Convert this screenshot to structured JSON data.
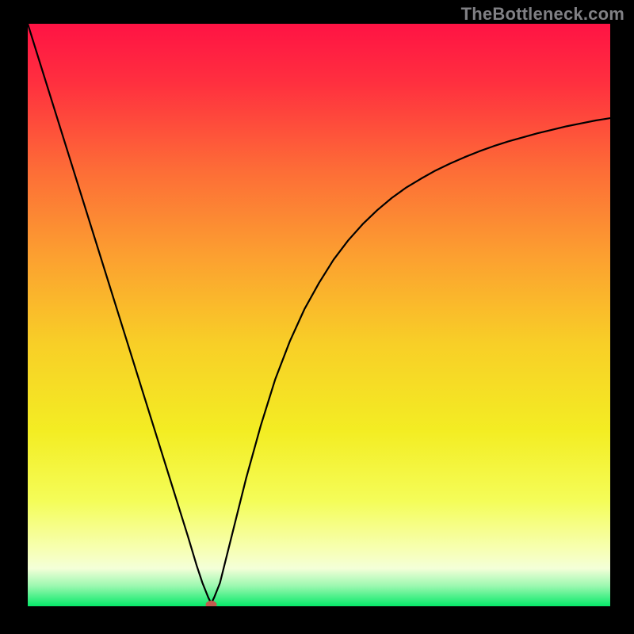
{
  "watermark": "TheBottleneck.com",
  "chart_data": {
    "type": "line",
    "title": "",
    "xlabel": "",
    "ylabel": "",
    "xlim": [
      0,
      100
    ],
    "ylim": [
      0,
      100
    ],
    "grid": false,
    "legend": false,
    "marker": {
      "x": 31.5,
      "y": 0,
      "color": "#c35a4f"
    },
    "series": [
      {
        "name": "curve",
        "color": "#000000",
        "x": [
          0,
          2.5,
          5,
          7.5,
          10,
          12.5,
          15,
          17.5,
          20,
          22.5,
          25,
          27.5,
          29,
          30,
          31,
          31.5,
          32,
          33,
          34,
          35,
          37.5,
          40,
          42.5,
          45,
          47.5,
          50,
          52.5,
          55,
          57.5,
          60,
          62.5,
          65,
          67.5,
          70,
          72.5,
          75,
          77.5,
          80,
          82.5,
          85,
          87.5,
          90,
          92.5,
          95,
          97.5,
          100
        ],
        "y": [
          100,
          92,
          84,
          76,
          68,
          60,
          52,
          44,
          36,
          28,
          20,
          12,
          7,
          4,
          1.5,
          0.5,
          1.5,
          4,
          8,
          12,
          22,
          31,
          39,
          45.5,
          51,
          55.5,
          59.5,
          62.8,
          65.6,
          68,
          70.1,
          71.9,
          73.4,
          74.8,
          76,
          77.1,
          78.1,
          79,
          79.8,
          80.5,
          81.2,
          81.8,
          82.4,
          82.9,
          83.4,
          83.8
        ]
      }
    ],
    "background_gradient": [
      {
        "stop": 0.0,
        "color": "#ff1344"
      },
      {
        "stop": 0.1,
        "color": "#ff2f3f"
      },
      {
        "stop": 0.25,
        "color": "#fd6c37"
      },
      {
        "stop": 0.4,
        "color": "#fca030"
      },
      {
        "stop": 0.55,
        "color": "#f8cf27"
      },
      {
        "stop": 0.7,
        "color": "#f3ed23"
      },
      {
        "stop": 0.82,
        "color": "#f4fd59"
      },
      {
        "stop": 0.9,
        "color": "#f7ffb0"
      },
      {
        "stop": 0.935,
        "color": "#f4ffd8"
      },
      {
        "stop": 0.965,
        "color": "#9cf8b0"
      },
      {
        "stop": 1.0,
        "color": "#06e969"
      }
    ]
  }
}
